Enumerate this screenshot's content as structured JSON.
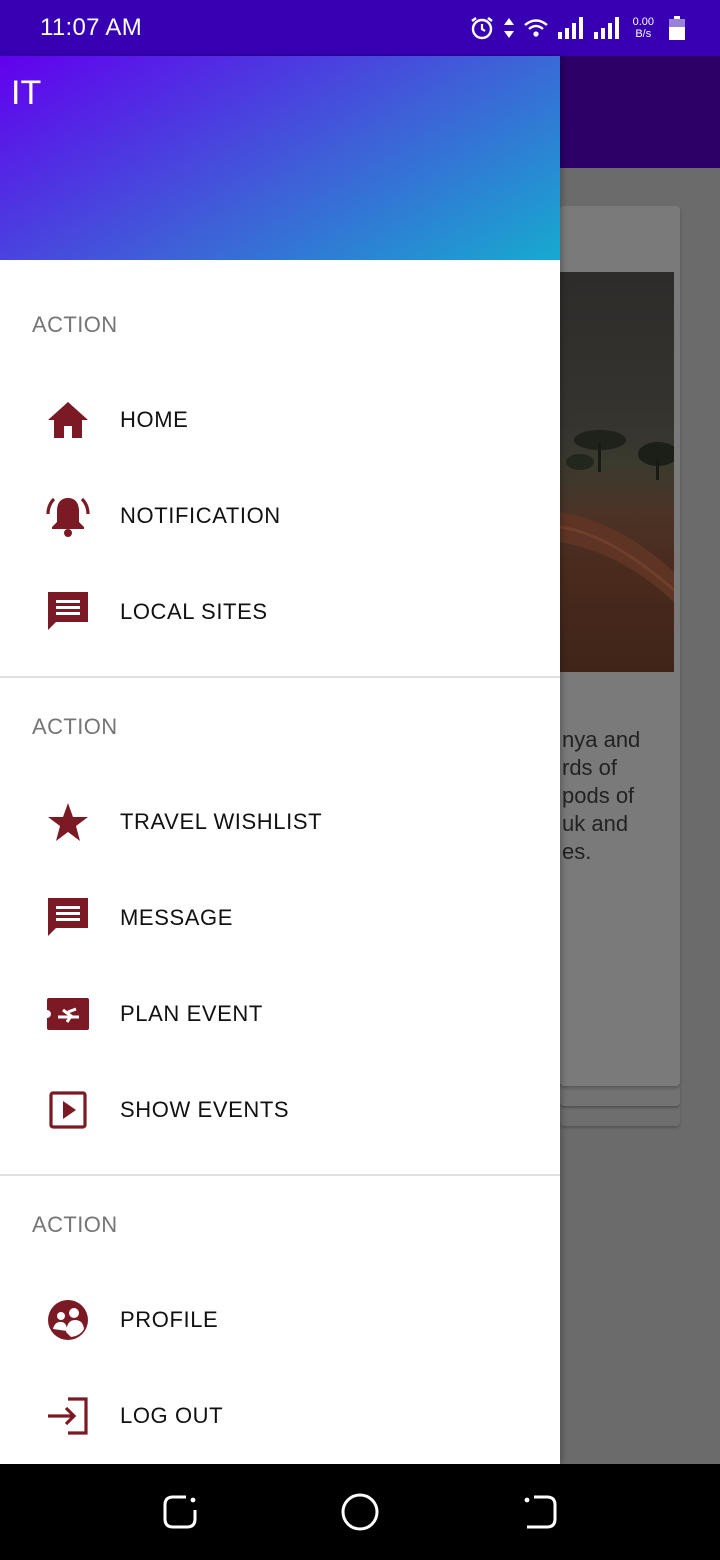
{
  "status_bar": {
    "time": "11:07 AM",
    "net_speed_value": "0.00",
    "net_speed_unit": "B/s",
    "icons": [
      "alarm-icon",
      "data-arrows-icon",
      "wifi-icon",
      "signal-icon",
      "signal-icon",
      "battery-icon"
    ]
  },
  "drawer": {
    "header_title": "IT",
    "header_gradient": [
      "#6200ee",
      "#17aacf"
    ],
    "icon_color": "#7b1a24",
    "sections": [
      {
        "title": "ACTION",
        "items": [
          {
            "label": "HOME",
            "icon": "home-icon"
          },
          {
            "label": "NOTIFICATION",
            "icon": "bell-ringing-icon"
          },
          {
            "label": "LOCAL SITES",
            "icon": "chat-icon"
          }
        ]
      },
      {
        "title": "ACTION",
        "items": [
          {
            "label": "TRAVEL WISHLIST",
            "icon": "star-icon"
          },
          {
            "label": "MESSAGE",
            "icon": "chat-icon"
          },
          {
            "label": "PLAN EVENT",
            "icon": "flight-ticket-icon"
          },
          {
            "label": "SHOW EVENTS",
            "icon": "play-box-icon"
          }
        ]
      },
      {
        "title": "ACTION",
        "items": [
          {
            "label": "PROFILE",
            "icon": "people-circle-icon"
          },
          {
            "label": "LOG OUT",
            "icon": "login-arrow-icon"
          }
        ]
      }
    ]
  },
  "background": {
    "text_lines": [
      "nya and",
      "rds of",
      "pods of",
      "uk and",
      "es."
    ]
  },
  "nav_bar": {
    "buttons": [
      "recents-icon",
      "home-circle-icon",
      "back-icon"
    ]
  }
}
